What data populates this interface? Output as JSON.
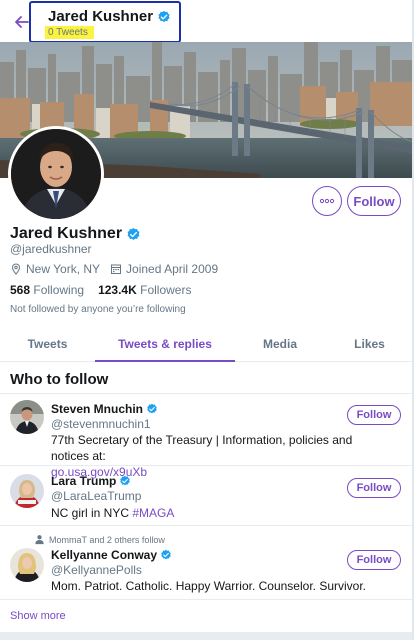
{
  "header": {
    "name": "Jared Kushner",
    "tweet_count": "0 Tweets"
  },
  "profile": {
    "name": "Jared Kushner",
    "handle": "@jaredkushner",
    "location": "New York, NY",
    "joined": "Joined April 2009",
    "following_count": "568",
    "following_label": "Following",
    "followers_count": "123.4K",
    "followers_label": "Followers",
    "not_followed": "Not followed by anyone you’re following",
    "follow_label": "Follow",
    "more_label": "⋯"
  },
  "tabs": [
    {
      "label": "Tweets",
      "active": false
    },
    {
      "label": "Tweets & replies",
      "active": true
    },
    {
      "label": "Media",
      "active": false
    },
    {
      "label": "Likes",
      "active": false
    }
  ],
  "who_to_follow": {
    "title": "Who to follow",
    "users": [
      {
        "name": "Steven Mnuchin",
        "handle": "@stevenmnuchin1",
        "bio": "77th Secretary of the Treasury | Information, policies and notices at:",
        "bio_link": "go.usa.gov/x9uXb",
        "follow_label": "Follow"
      },
      {
        "name": "Lara Trump",
        "handle": "@LaraLeaTrump",
        "bio": "NC girl in NYC ",
        "bio_link": "#MAGA",
        "follow_label": "Follow"
      },
      {
        "context": "MommaT and 2 others follow",
        "name": "Kellyanne Conway",
        "handle": "@KellyannePolls",
        "bio": "Mom. Patriot. Catholic. Happy Warrior. Counselor. Survivor.",
        "follow_label": "Follow"
      }
    ],
    "show_more": "Show more"
  },
  "colors": {
    "accent": "#794bc4",
    "verified": "#1da1f2",
    "highlight": "#fbf33d",
    "annotation_box": "#1b2fa8"
  }
}
